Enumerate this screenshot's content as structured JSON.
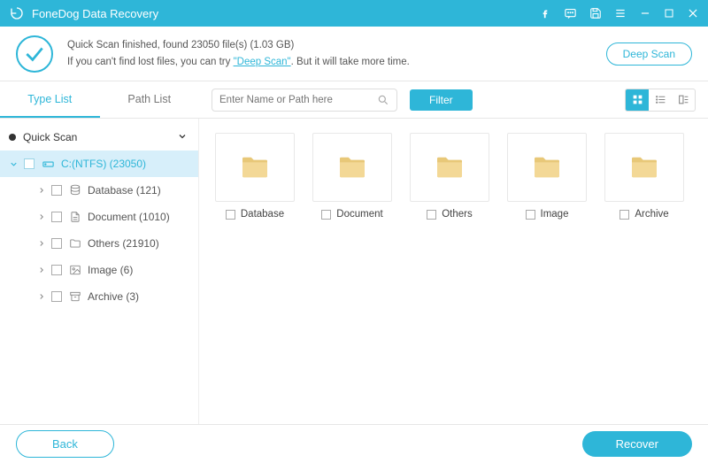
{
  "titlebar": {
    "app_name": "FoneDog Data Recovery"
  },
  "banner": {
    "line1": "Quick Scan finished, found 23050 file(s) (1.03 GB)",
    "line2_pre": "If you can't find lost files, you can try ",
    "deep_link": "\"Deep Scan\"",
    "line2_post": ". But it will take more time.",
    "deep_scan_btn": "Deep Scan"
  },
  "toolbar": {
    "tabs": [
      "Type List",
      "Path List"
    ],
    "active_tab": 0,
    "search_placeholder": "Enter Name or Path here",
    "filter_label": "Filter"
  },
  "sidebar": {
    "root": "Quick Scan",
    "drive": "C:(NTFS) (23050)",
    "children": [
      {
        "label": "Database (121)",
        "icon": "database"
      },
      {
        "label": "Document (1010)",
        "icon": "document"
      },
      {
        "label": "Others (21910)",
        "icon": "folder"
      },
      {
        "label": "Image (6)",
        "icon": "image"
      },
      {
        "label": "Archive (3)",
        "icon": "archive"
      }
    ]
  },
  "content": {
    "folders": [
      "Database",
      "Document",
      "Others",
      "Image",
      "Archive"
    ]
  },
  "footer": {
    "back": "Back",
    "recover": "Recover"
  },
  "colors": {
    "accent": "#2eb6d8"
  }
}
